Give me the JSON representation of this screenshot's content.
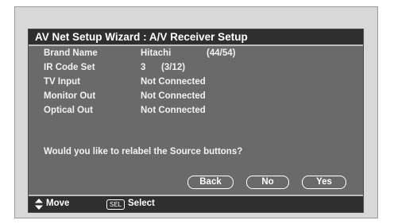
{
  "title": "AV Net Setup Wizard : A/V Receiver Setup",
  "rows": [
    {
      "label": "Brand Name",
      "value": "Hitachi",
      "count": "(44/54)"
    },
    {
      "label": "IR Code Set",
      "value": "3",
      "count": "(3/12)"
    },
    {
      "label": "TV Input",
      "value": "Not Connected",
      "count": ""
    },
    {
      "label": "Monitor Out",
      "value": "Not Connected",
      "count": ""
    },
    {
      "label": "Optical Out",
      "value": "Not Connected",
      "count": ""
    }
  ],
  "question": "Would you like to relabel the Source buttons?",
  "buttons": {
    "back": "Back",
    "no": "No",
    "yes": "Yes"
  },
  "footer": {
    "move_label": "Move",
    "sel_icon_text": "SEL",
    "select_label": "Select"
  }
}
